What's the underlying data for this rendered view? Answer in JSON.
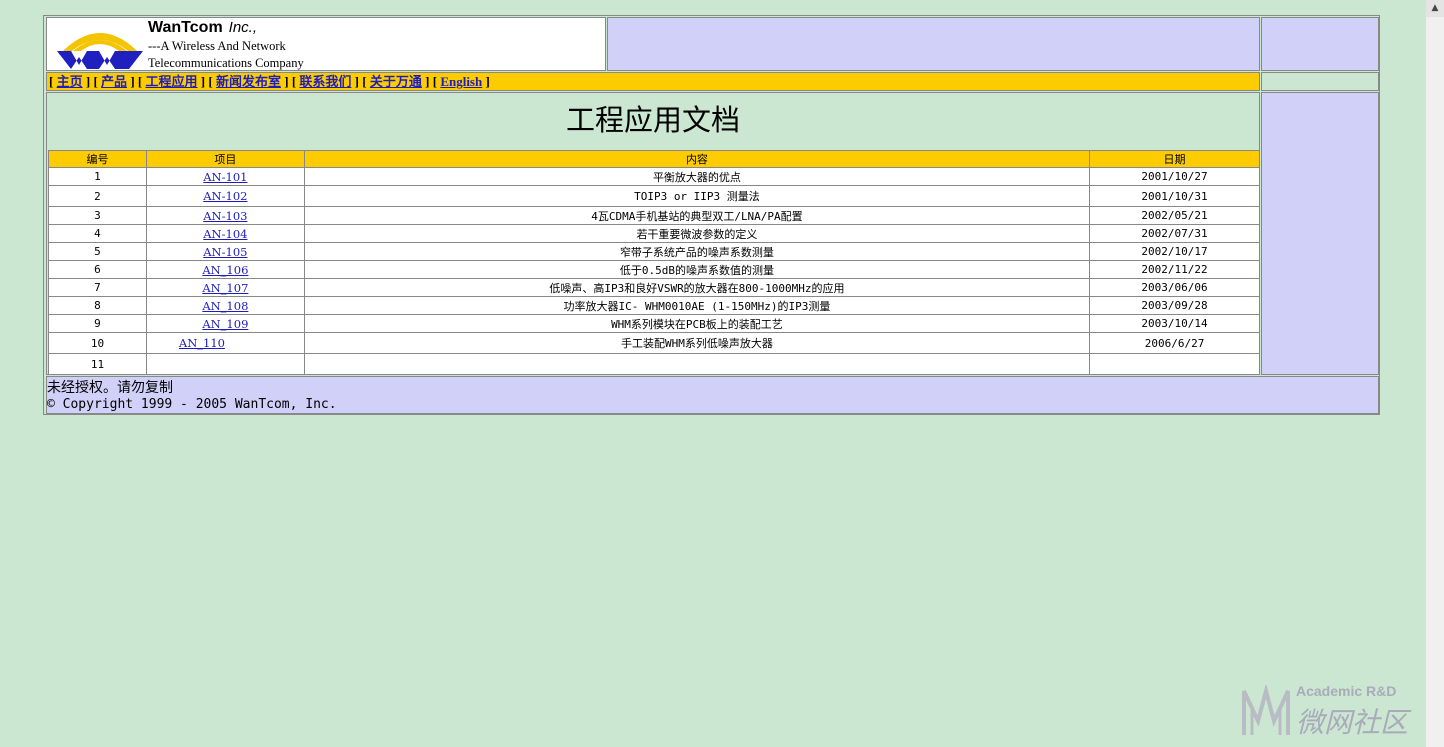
{
  "header": {
    "company_name": "WanTcom",
    "company_suffix": "Inc.,",
    "tagline_1": "---A Wireless And Network",
    "tagline_2": "Telecommunications Company"
  },
  "nav": {
    "items": [
      {
        "label": "主页"
      },
      {
        "label": "产品"
      },
      {
        "label": "工程应用"
      },
      {
        "label": "新闻发布室"
      },
      {
        "label": "联系我们"
      },
      {
        "label": "关于万通"
      },
      {
        "label": "English"
      }
    ],
    "open_bracket": "[",
    "close_bracket": "]"
  },
  "main": {
    "title": "工程应用文档",
    "table": {
      "headers": [
        "编号",
        "项目",
        "内容",
        "日期"
      ],
      "rows": [
        {
          "no": "1",
          "code": "AN-101",
          "content": "平衡放大器的优点",
          "date": "2001/10/27"
        },
        {
          "no": "2",
          "code": "AN-102",
          "content": "TOIP3 or IIP3 测量法",
          "date": "2001/10/31"
        },
        {
          "no": "3",
          "code": "AN-103",
          "content": "4瓦CDMA手机基站的典型双工/LNA/PA配置",
          "date": "2002/05/21"
        },
        {
          "no": "4",
          "code": "AN-104",
          "content": "若干重要微波参数的定义",
          "date": "2002/07/31"
        },
        {
          "no": "5",
          "code": "AN-105",
          "content": "窄带子系统产品的噪声系数测量",
          "date": "2002/10/17"
        },
        {
          "no": "6",
          "code": "AN_106",
          "content": "低于0.5dB的噪声系数值的测量",
          "date": "2002/11/22"
        },
        {
          "no": "7",
          "code": "AN_107",
          "content": "低噪声、高IP3和良好VSWR的放大器在800-1000MHz的应用",
          "date": "2003/06/06"
        },
        {
          "no": "8",
          "code": "AN_108",
          "content": "功率放大器IC- WHM0010AE (1-150MHz)的IP3测量",
          "date": "2003/09/28"
        },
        {
          "no": "9",
          "code": "AN_109",
          "content": "WHM系列模块在PCB板上的装配工艺",
          "date": "2003/10/14"
        },
        {
          "no": "10",
          "code": "AN_110",
          "content": "手工装配WHM系列低噪声放大器",
          "date": "2006/6/27"
        },
        {
          "no": "11",
          "code": "",
          "content": "",
          "date": ""
        }
      ]
    }
  },
  "footer": {
    "notice": "未经授权。请勿复制",
    "copyright": "© Copyright 1999 - 2005 WanTcom, Inc."
  },
  "watermark": {
    "text_en": "Academic R&D",
    "text_cn": "微网社区"
  },
  "colors": {
    "page_bg": "#cce7d1",
    "panel_blue": "#d0d0f8",
    "nav_yellow": "#fccc00",
    "link_blue": "#1d1dbf"
  }
}
